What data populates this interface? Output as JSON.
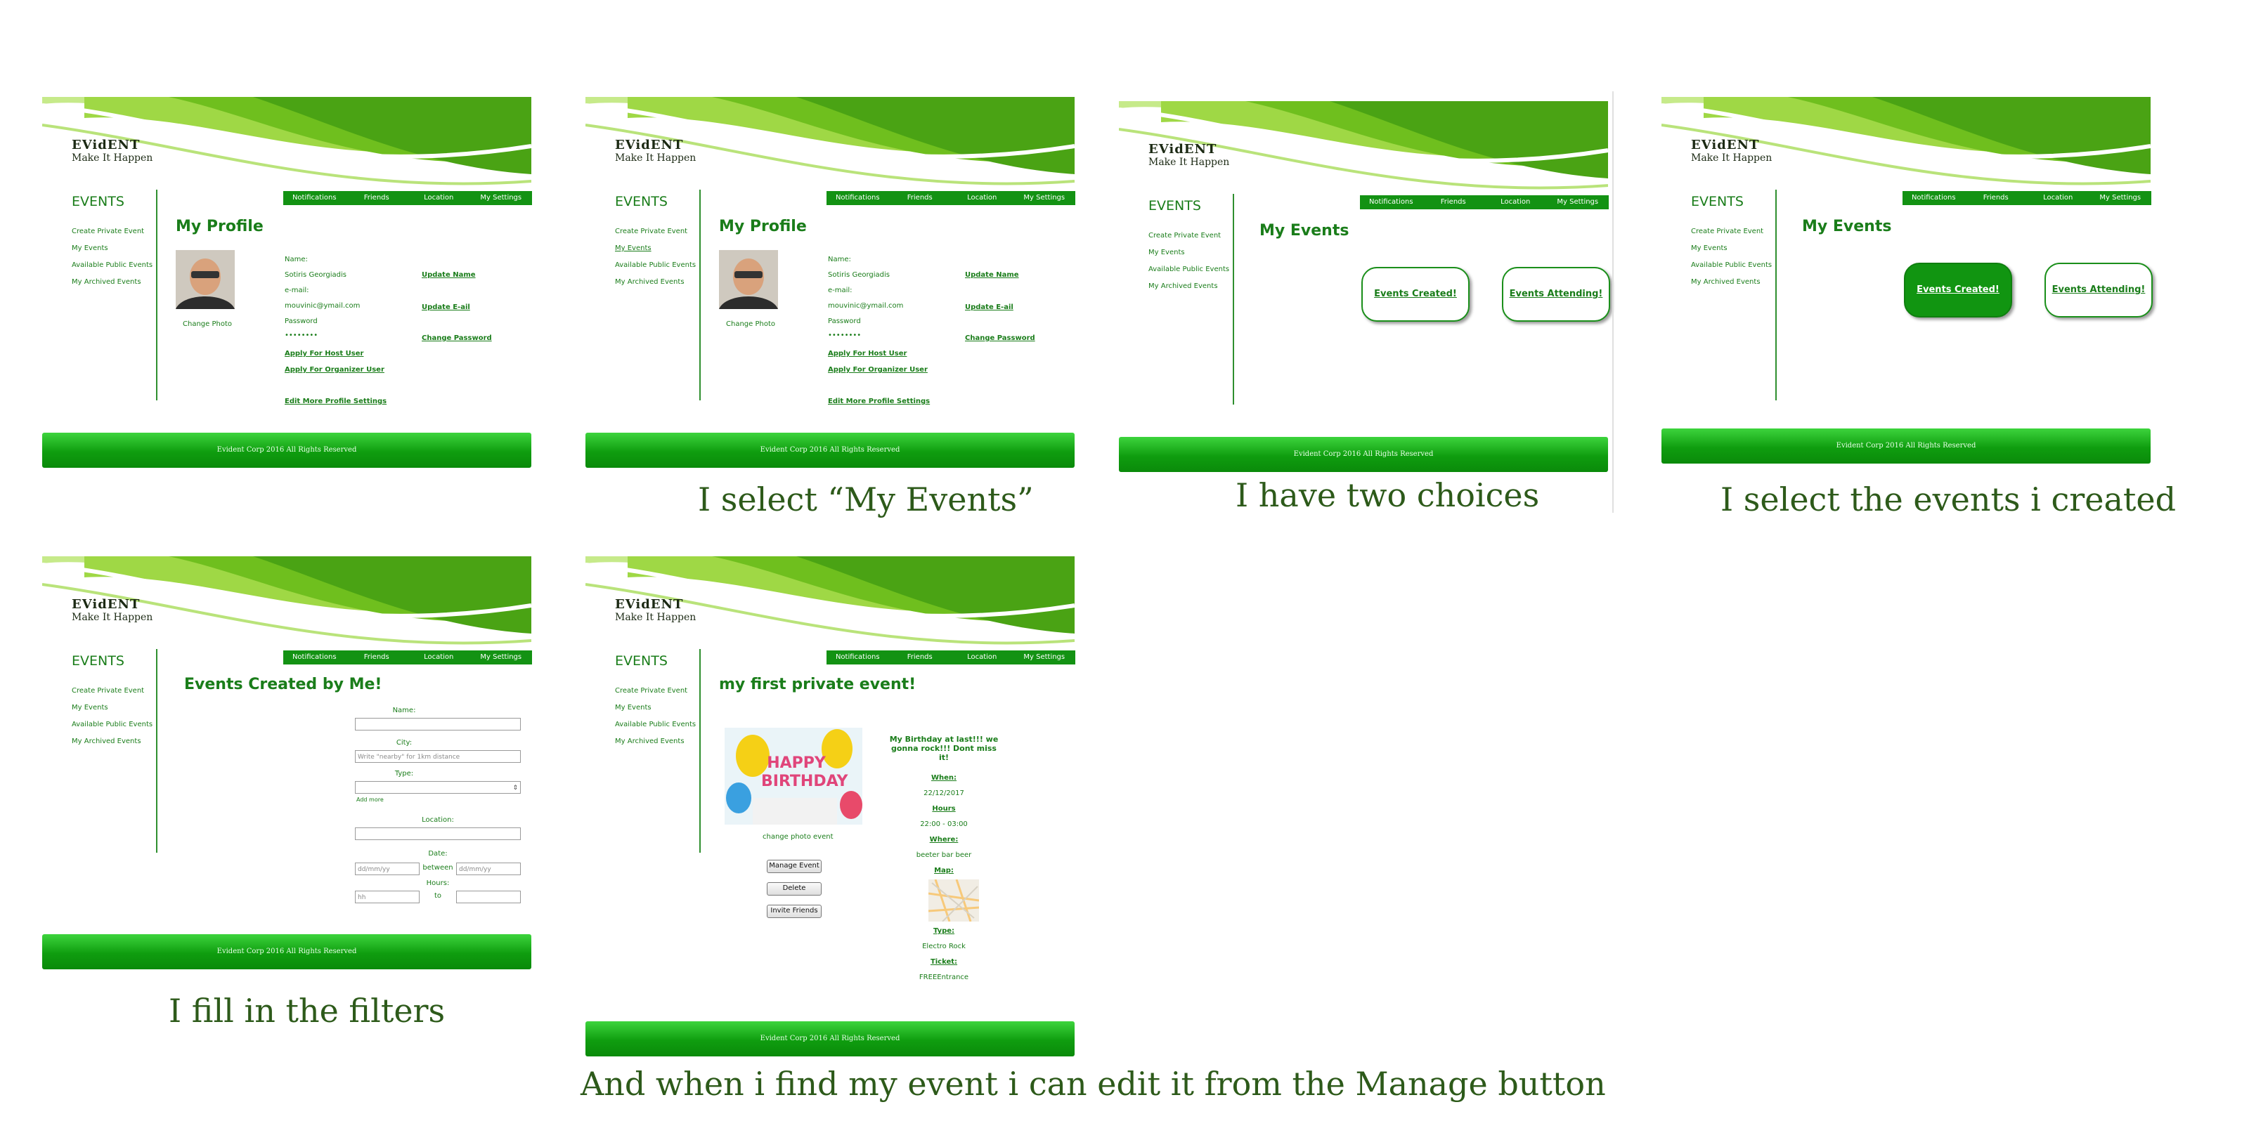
{
  "site": {
    "brand_name": "EVidENT",
    "brand_tagline": "Make It Happen",
    "sidebar_title": "EVENTS",
    "sidebar_items": [
      "Create Private Event",
      "My Events",
      "Available Public Events",
      "My Archived Events"
    ],
    "topnav": [
      "Notifications",
      "Friends",
      "Location",
      "My Settings"
    ],
    "footer": "Evident Corp  2016 All Rights Reserved"
  },
  "profile": {
    "title": "My Profile",
    "change_photo": "Change Photo",
    "name_label": "Name:",
    "name_value": "Sotiris Georgiadis",
    "email_label": "e-mail:",
    "email_value": "mouvinic@ymail.com",
    "password_label": "Password",
    "password_value": "••••••••",
    "update_name": "Update Name",
    "update_email": "Update E-ail",
    "change_password": "Change Password",
    "apply_host": "Apply For Host User",
    "apply_organizer": "Apply For Organizer User",
    "edit_more": "Edit More Profile Settings"
  },
  "my_events": {
    "title": "My Events",
    "created_button": "Events Created!",
    "attending_button": "Events Attending!"
  },
  "filters": {
    "title": "Events Created by Me!",
    "name_label": "Name:",
    "city_label": "City:",
    "city_placeholder": "Write \"nearby\" for 1km distance",
    "type_label": "Type:",
    "add_more": "Add more",
    "location_label": "Location:",
    "date_label": "Date:",
    "date_placeholder": "dd/mm/yy",
    "between_label": "between",
    "hours_label": "Hours:",
    "hours_placeholder": "hh",
    "to_label": "to"
  },
  "event": {
    "title": "my first private event!",
    "change_photo": "change photo event",
    "buttons": [
      "Manage Event",
      "Delete",
      "Invite Friends"
    ],
    "description": "My Birthday at last!!! we gonna rock!!! Dont miss it!",
    "when_label": "When:",
    "when_value": "22/12/2017",
    "hours_label": "Hours",
    "hours_value": "22:00 - 03:00",
    "where_label": "Where:",
    "where_value": "beeter bar beer",
    "map_label": "Map:",
    "type_label": "Type:",
    "type_value": "Electro  Rock",
    "ticket_label": "Ticket:",
    "ticket_value": "FREEEntrance",
    "balloon_text": "HAPPY BIRTHDAY"
  },
  "captions": {
    "c2": "I select “My Events”",
    "c3": "I have two choices",
    "c4": "I select the events i created",
    "c5": "I fill in the filters",
    "c6": "And when i find my event i can edit it from the Manage button"
  }
}
